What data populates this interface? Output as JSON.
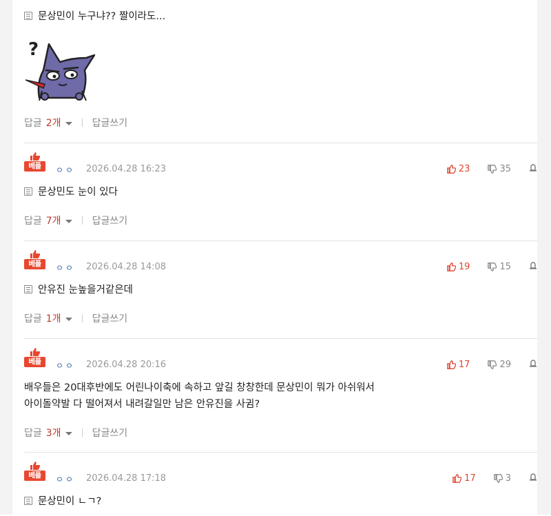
{
  "first_comment": {
    "text": "문상민이 누구냐?? 짤이라도...",
    "reply_label": "답글",
    "reply_count": "2개",
    "write_reply": "답글쓰기"
  },
  "best_badge": "베플",
  "comments": [
    {
      "author": "ㅇㅇ",
      "date": "2026.04.28 16:23",
      "up": "23",
      "down": "35",
      "lines": [
        "문상민도 눈이 있다"
      ],
      "reply_label": "답글",
      "reply_count": "7개",
      "write_reply": "답글쓰기"
    },
    {
      "author": "ㅇㅇ",
      "date": "2026.04.28 14:08",
      "up": "19",
      "down": "15",
      "lines": [
        "안유진 눈높을거같은데"
      ],
      "reply_label": "답글",
      "reply_count": "1개",
      "write_reply": "답글쓰기"
    },
    {
      "author": "ㅇㅇ",
      "date": "2026.04.28 20:16",
      "up": "17",
      "down": "29",
      "lines": [
        "배우들은 20대후반에도 어린나이축에 속하고 앞길 창창한데 문상민이 뭐가 아쉬워서",
        "아이돌약발 다 떨어져서 내려갈일만 남은 안유진을 사귐?"
      ],
      "reply_label": "답글",
      "reply_count": "3개",
      "write_reply": "답글쓰기"
    },
    {
      "author": "ㅇㅇ",
      "date": "2026.04.28 17:18",
      "up": "17",
      "down": "3",
      "lines": [
        "문상민이 ㄴㄱ?"
      ]
    }
  ],
  "colors": {
    "accent": "#e8472f",
    "up": "#e0432f",
    "muted": "#999999",
    "author": "#3a6bb0"
  }
}
